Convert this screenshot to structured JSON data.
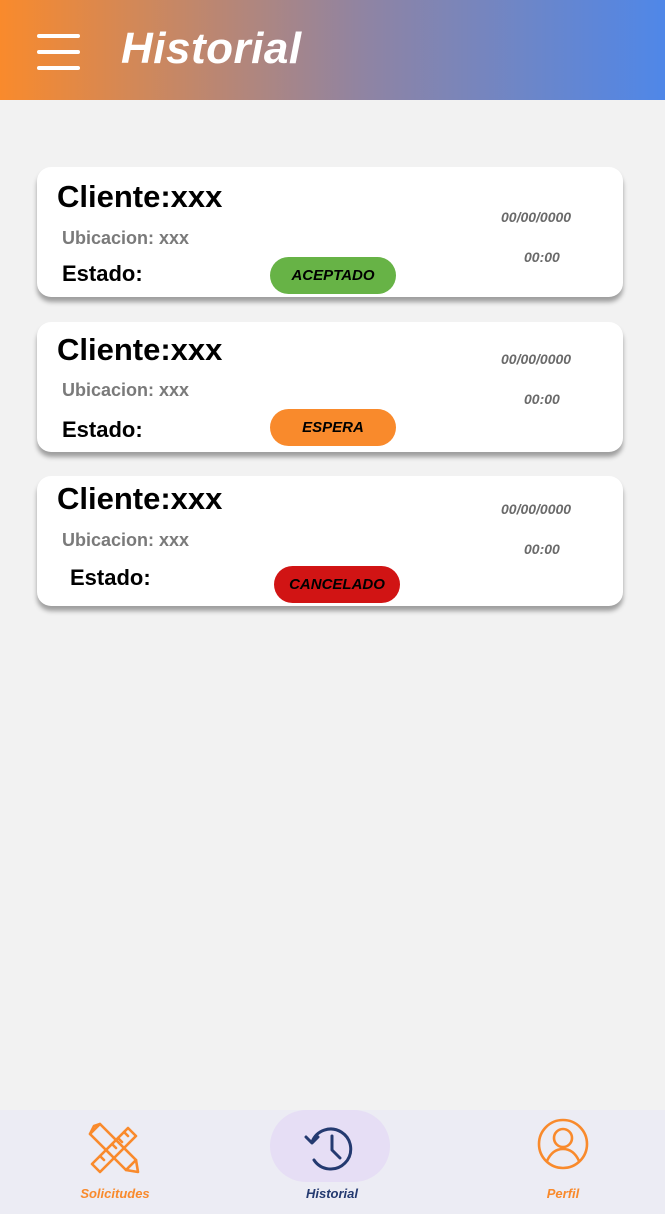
{
  "header": {
    "title": "Historial"
  },
  "cards": [
    {
      "client": "Cliente:xxx",
      "location": "Ubicacion: xxx",
      "state_label": "Estado:",
      "status": "ACEPTADO",
      "status_color": "#67b346",
      "date": "00/00/0000",
      "time": "00:00"
    },
    {
      "client": "Cliente:xxx",
      "location": "Ubicacion: xxx",
      "state_label": "Estado:",
      "status": "ESPERA",
      "status_color": "#f98a2c",
      "date": "00/00/0000",
      "time": "00:00"
    },
    {
      "client": "Cliente:xxx",
      "location": "Ubicacion: xxx",
      "state_label": "Estado:",
      "status": "CANCELADO",
      "status_color": "#d11414",
      "date": "00/00/0000",
      "time": "00:00"
    }
  ],
  "nav": {
    "solicitudes": {
      "label": "Solicitudes",
      "icon": "pencil-ruler-icon",
      "color": "#f98a2c"
    },
    "historial": {
      "label": "Historial",
      "icon": "history-icon",
      "color": "#243a70"
    },
    "perfil": {
      "label": "Perfil",
      "icon": "user-circle-icon",
      "color": "#f98a2c"
    }
  }
}
